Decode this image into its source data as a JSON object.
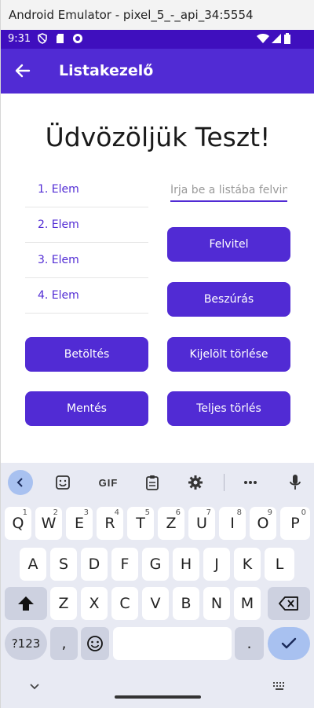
{
  "window": {
    "title": "Android Emulator - pixel_5_-_api_34:5554"
  },
  "statusbar": {
    "time": "9:31"
  },
  "appbar": {
    "title": "Listakezelő"
  },
  "main": {
    "welcome": "Üdvözöljük Teszt!",
    "list_items": [
      "1. Elem",
      "2. Elem",
      "3. Elem",
      "4. Elem"
    ],
    "input_placeholder": "Írja be a listába felvinni",
    "buttons": {
      "add": "Felvitel",
      "insert": "Beszúrás",
      "load": "Betöltés",
      "delete_selected": "Kijelölt törlése",
      "save": "Mentés",
      "delete_all": "Teljes törlés"
    }
  },
  "keyboard": {
    "toolbar": {
      "gif": "GIF"
    },
    "row1": [
      {
        "k": "Q",
        "h": "1"
      },
      {
        "k": "W",
        "h": "2"
      },
      {
        "k": "E",
        "h": "3"
      },
      {
        "k": "R",
        "h": "4"
      },
      {
        "k": "T",
        "h": "5"
      },
      {
        "k": "Z",
        "h": "6"
      },
      {
        "k": "U",
        "h": "7"
      },
      {
        "k": "I",
        "h": "8"
      },
      {
        "k": "O",
        "h": "9"
      },
      {
        "k": "P",
        "h": "0"
      }
    ],
    "row2": [
      "A",
      "S",
      "D",
      "F",
      "G",
      "H",
      "J",
      "K",
      "L"
    ],
    "row3": [
      "Z",
      "X",
      "C",
      "V",
      "B",
      "N",
      "M"
    ],
    "bottom": {
      "symbols": "?123",
      "comma": ",",
      "period": "."
    }
  },
  "colors": {
    "primary": "#512bd4",
    "statusbar": "#3f0fbe",
    "keyboard_bg": "#e8eaf3"
  }
}
